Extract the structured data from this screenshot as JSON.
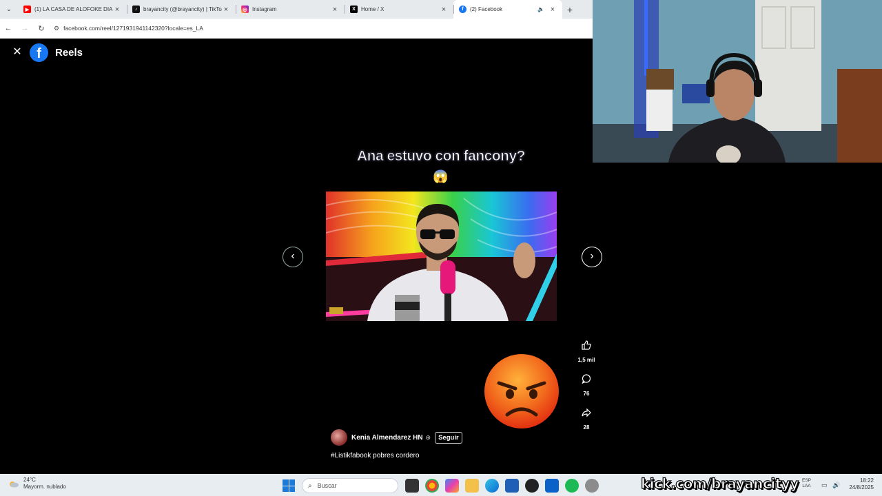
{
  "browser": {
    "tabs": [
      {
        "title": "(1) LA CASA DE ALOFOKE DIA ",
        "favicon": "youtube-icon",
        "color": "#ff0000",
        "active": false
      },
      {
        "title": "brayancity (@brayancity) | TikTo",
        "favicon": "tiktok-icon",
        "color": "#111111",
        "active": false
      },
      {
        "title": "Instagram",
        "favicon": "instagram-icon",
        "color": "#d6249f",
        "active": false
      },
      {
        "title": "Home / X",
        "favicon": "x-icon",
        "color": "#000000",
        "active": false
      },
      {
        "title": "(2) Facebook",
        "favicon": "facebook-icon",
        "color": "#1877f2",
        "active": true
      }
    ],
    "url": "facebook.com/reel/1271931941142320?locale=es_LA"
  },
  "reels": {
    "title": "Reels",
    "caption": "Ana estuvo con fancony?",
    "caption_emoji": "😱",
    "actions": {
      "likes": "1,5 mil",
      "comments": "76",
      "shares": "28"
    },
    "author": "Kenia Almendarez HN",
    "follow_label": "Seguir",
    "hashtag_text": "#Listikfabook pobres cordero"
  },
  "taskbar": {
    "temperature": "24°C",
    "weather_desc": "Mayorm. nublado",
    "search_placeholder": "Buscar",
    "lang_top": "ESP",
    "lang_bottom": "LAA",
    "time": "18:22",
    "date": "24/8/2025"
  },
  "overlay": {
    "kick_url": "kick.com/brayancityy"
  }
}
